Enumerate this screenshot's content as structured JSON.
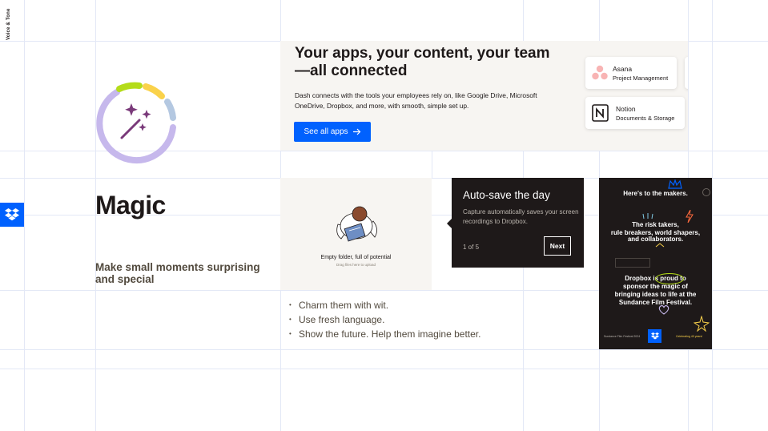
{
  "sidebar": {
    "label": "Voice & Tone"
  },
  "magic": {
    "title": "Magic",
    "subtitle": "Make small moments surprising and special"
  },
  "connect": {
    "title": "Your apps, your content, your team—all connected",
    "body": "Dash connects with the tools your employees rely on, like Google Drive, Microsoft OneDrive, Dropbox, and more, with smooth, simple set up.",
    "button_label": "See all apps",
    "apps": [
      {
        "name": "Asana",
        "desc": "Project Management"
      },
      {
        "name": "Notion",
        "desc": "Documents & Storage"
      }
    ]
  },
  "empty_state": {
    "title": "Empty folder, full of potential",
    "subtitle": "Drag files here to upload"
  },
  "tooltip": {
    "title": "Auto-save the day",
    "body": "Capture automatically saves your screen recordings to Dropbox.",
    "counter": "1 of 5",
    "next_label": "Next"
  },
  "bullets": [
    "Charm them with wit.",
    "Use fresh language.",
    "Show the future. Help them imagine better."
  ],
  "poster": {
    "heading": "Here's to the makers.",
    "line1": "The risk takers,",
    "line2": "rule breakers, world shapers,",
    "line3": "and collaborators.",
    "line4": "Dropbox is proud to",
    "line5": "sponsor the magic of",
    "line6": "bringing ideas to life at the",
    "line7": "Sundance Film Festival.",
    "footer_left": "Sundance Film Festival 2024",
    "footer_right": "Celebrating 40 years!"
  },
  "colors": {
    "dropbox_blue": "#0061fe",
    "ink": "#1e1919",
    "panel": "#f7f5f2",
    "ring_purple": "#c6b8ec",
    "ring_green": "#b4dc19",
    "ring_yellow": "#fad24b",
    "ring_blue": "#b4c8e1",
    "wand_purple": "#7a3a7a"
  }
}
